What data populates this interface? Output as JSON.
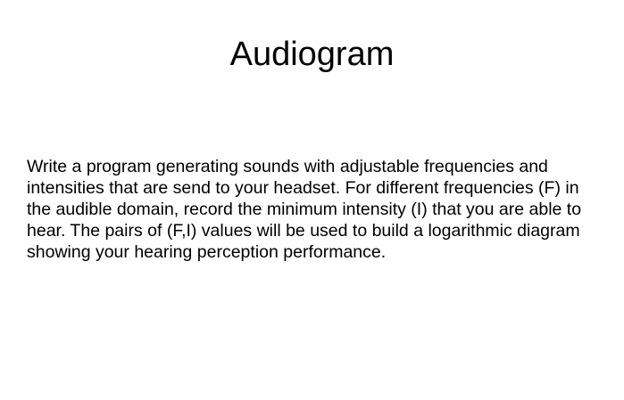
{
  "slide": {
    "title": "Audiogram",
    "body": "Write a program generating sounds with adjustable frequencies and intensities that are send to your headset. For different frequencies (F) in the audible domain, record the minimum intensity (I) that you are able to hear. The pairs of (F,I) values will be used to build a logarithmic diagram showing your hearing perception performance."
  }
}
